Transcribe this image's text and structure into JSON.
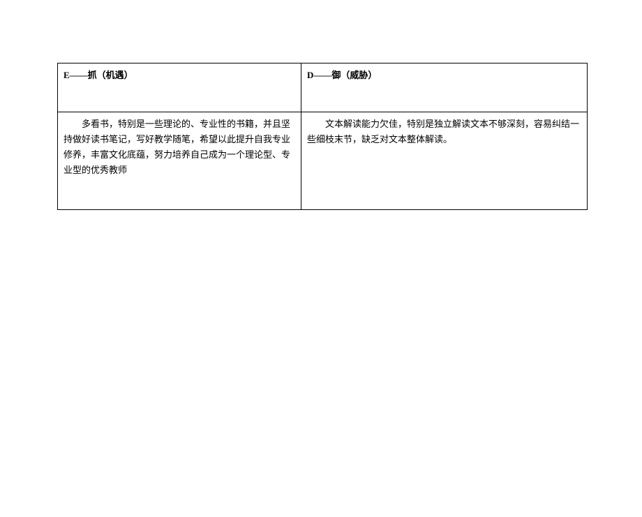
{
  "table": {
    "headers": {
      "left": "E——抓（机遇）",
      "right": "D——御（威胁）"
    },
    "content": {
      "left": "多看书，特别是一些理论的、专业性的书籍，并且坚持做好读书笔记，写好教学随笔，希望以此提升自我专业修养，丰富文化底蕴，努力培养自己成为一个理论型、专业型的优秀教师",
      "right": "文本解读能力欠佳，特别是独立解读文本不够深刻，容易纠结一些细枝末节，缺乏对文本整体解读。"
    }
  }
}
